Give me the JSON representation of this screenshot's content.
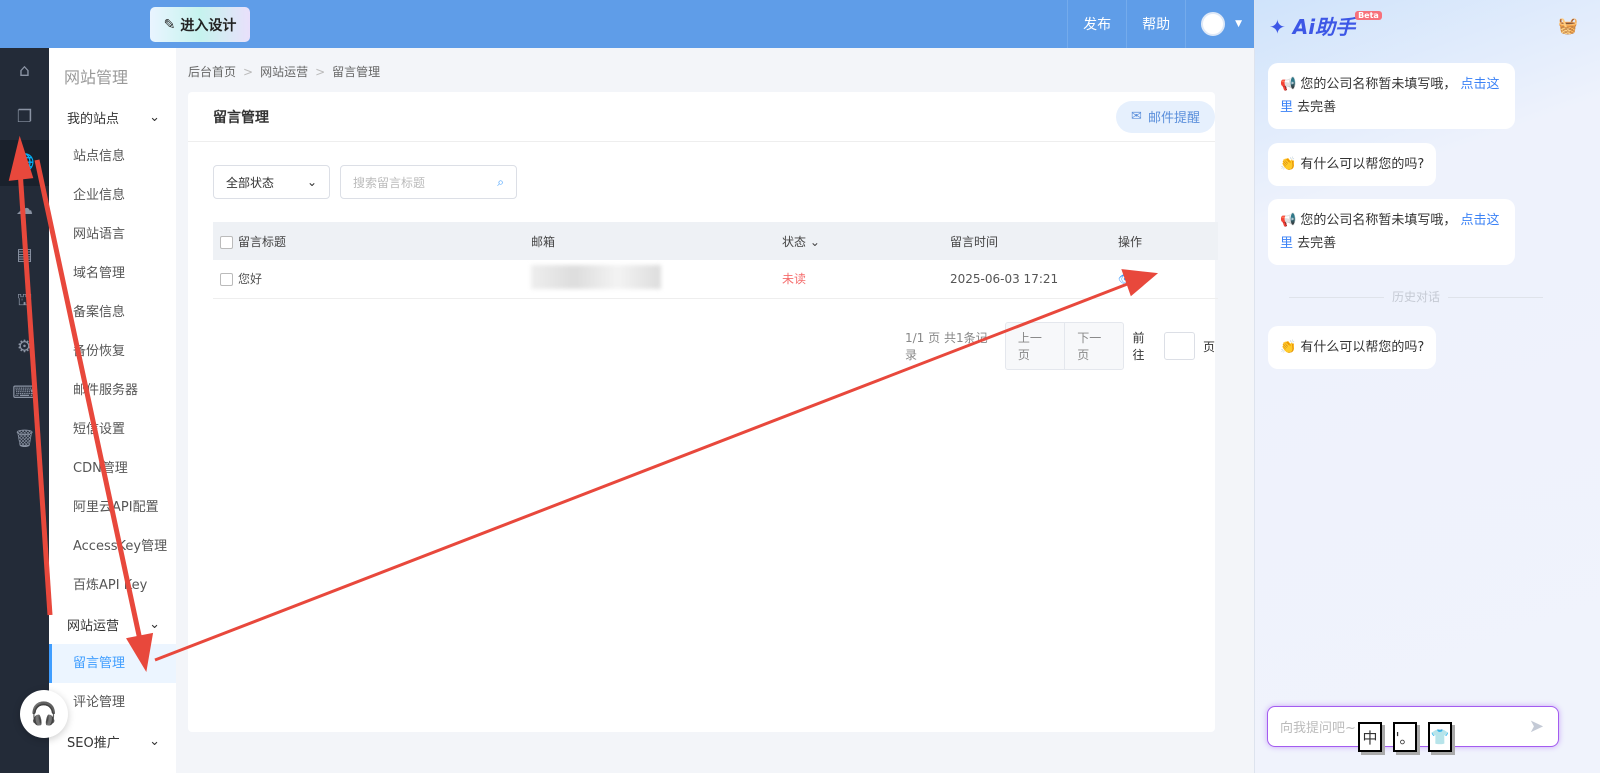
{
  "topbar": {
    "design_label": "进入设计",
    "publish": "发布",
    "help": "帮助"
  },
  "sidenav": {
    "title": "网站管理",
    "groups": [
      {
        "label": "我的站点",
        "items": [
          "站点信息",
          "企业信息",
          "网站语言",
          "域名管理",
          "备案信息",
          "备份恢复",
          "邮件服务器",
          "短信设置",
          "CDN管理",
          "阿里云API配置",
          "AccessKey管理",
          "百炼API Key"
        ]
      },
      {
        "label": "网站运营",
        "items": [
          "留言管理",
          "评论管理"
        ]
      },
      {
        "label": "SEO推广",
        "items": []
      }
    ]
  },
  "breadcrumb": [
    "后台首页",
    "网站运营",
    "留言管理"
  ],
  "card": {
    "title": "留言管理",
    "mail_button": "邮件提醒",
    "filter": {
      "status": "全部状态",
      "search_placeholder": "搜索留言标题"
    },
    "table": {
      "headers": [
        "留言标题",
        "邮箱",
        "状态",
        "留言时间",
        "操作"
      ],
      "rows": [
        {
          "title": "您好",
          "email": "",
          "status": "未读",
          "time": "2025-06-03 17:21"
        }
      ]
    },
    "pager": {
      "info": "1/1 页 共1条记录",
      "prev": "上一页",
      "next": "下一页",
      "goto": "前往",
      "page_unit": "页"
    }
  },
  "ai": {
    "title": "Ai助手",
    "beta": "Beta",
    "messages": [
      {
        "icon": "📢",
        "text": "您的公司名称暂未填写哦，",
        "link": "点击这里",
        "after": "去完善"
      },
      {
        "icon": "👏",
        "text": "有什么可以帮您的吗?"
      },
      {
        "icon": "📢",
        "text": "您的公司名称暂未填写哦，",
        "link": "点击这里",
        "after": "去完善"
      }
    ],
    "history": "历史对话",
    "history_messages": [
      {
        "icon": "👏",
        "text": "有什么可以帮您的吗?"
      }
    ],
    "input_placeholder": "向我提问吧~",
    "ime": [
      "中",
      "'。",
      "👕"
    ]
  },
  "colors": {
    "topbar": "#5f9de8",
    "accent": "#409eff",
    "unread": "#f56c6c"
  }
}
